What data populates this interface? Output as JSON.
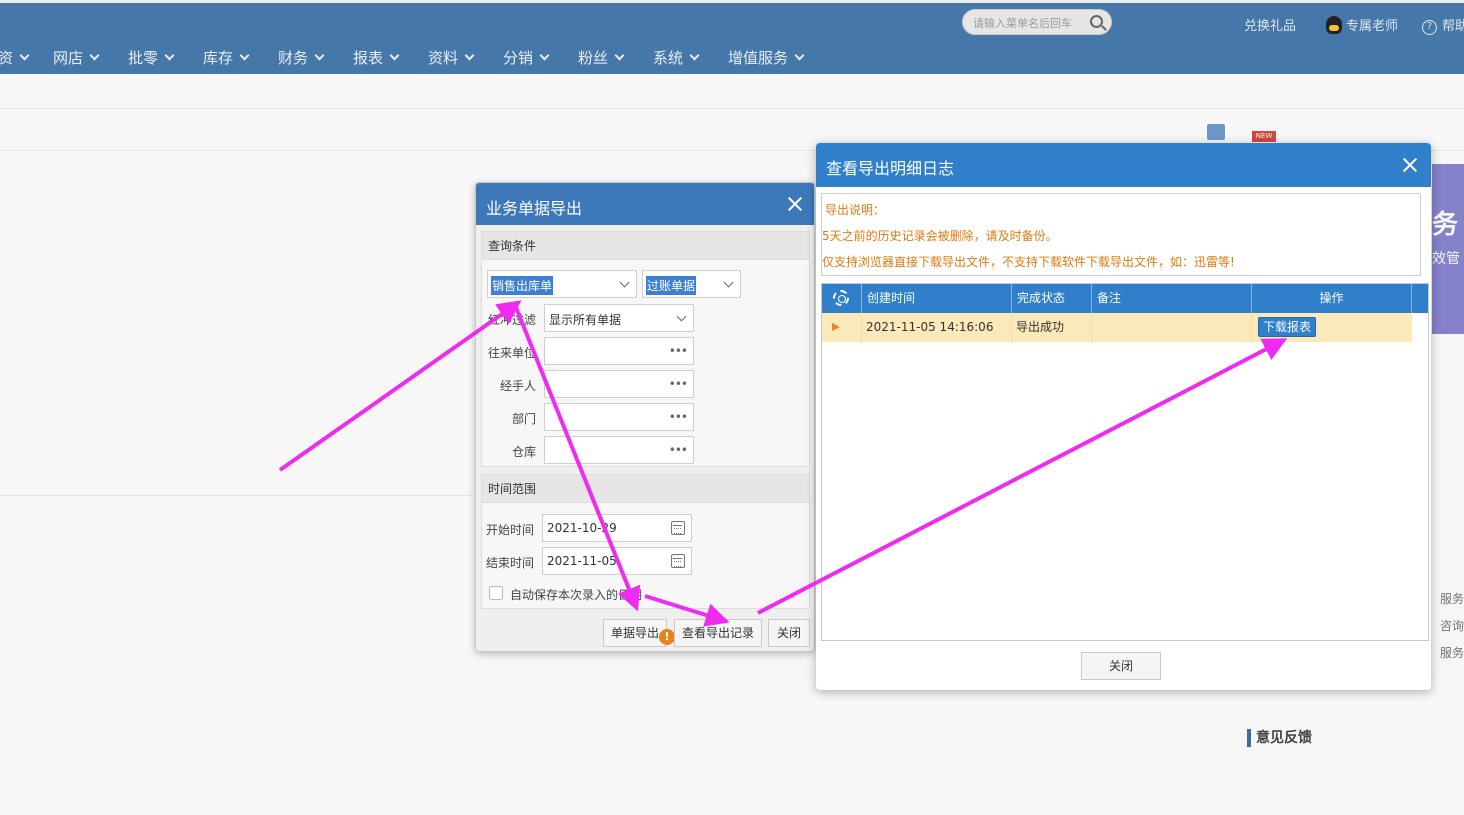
{
  "topbar": {
    "search_placeholder": "请输入菜单名后回车",
    "exchange_gift": "兑换礼品",
    "teacher": "专属老师",
    "help": "帮助"
  },
  "nav": [
    "资",
    "网店",
    "批零",
    "库存",
    "财务",
    "报表",
    "资料",
    "分销",
    "粉丝",
    "系统",
    "增值服务"
  ],
  "side": {
    "banner_big": "务",
    "banner_small": "效管",
    "lines": [
      "服务",
      "咨询",
      "服务"
    ],
    "feedback": "意见反馈",
    "new_badge": "NEW"
  },
  "export_dialog": {
    "title": "业务单据导出",
    "query_section": "查询条件",
    "bill_type": "销售出库单",
    "bill_status": "过账单据",
    "filter_label": "红冲过滤",
    "filter_value": "显示所有单据",
    "partner_label": "往来单位",
    "handler_label": "经手人",
    "dept_label": "部门",
    "warehouse_label": "仓库",
    "time_section": "时间范围",
    "start_label": "开始时间",
    "start_value": "2021-10-29",
    "end_label": "结束时间",
    "end_value": "2021-11-05",
    "auto_save": "自动保存本次录入的日期",
    "export_button": "单据导出",
    "view_log_button": "查看导出记录",
    "close_button": "关闭"
  },
  "log_dialog": {
    "title": "查看导出明细日志",
    "notes": [
      "导出说明：",
      "5天之前的历史记录会被删除，请及时备份。",
      "仅支持浏览器直接下载导出文件，不支持下载软件下载导出文件，如：迅雷等!"
    ],
    "columns": [
      "创建时间",
      "完成状态",
      "备注",
      "操作"
    ],
    "rows": [
      {
        "created": "2021-11-05 14:16:06",
        "status": "导出成功",
        "remark": "",
        "action": "下载报表"
      }
    ],
    "close_button": "关闭"
  },
  "colors": {
    "topbar": "#4577a9",
    "dialog_header": "#2f7fcb",
    "annotation_arrow": "#ee2bee",
    "note_text": "#e27a10",
    "row_highlight": "#fce9b9"
  }
}
